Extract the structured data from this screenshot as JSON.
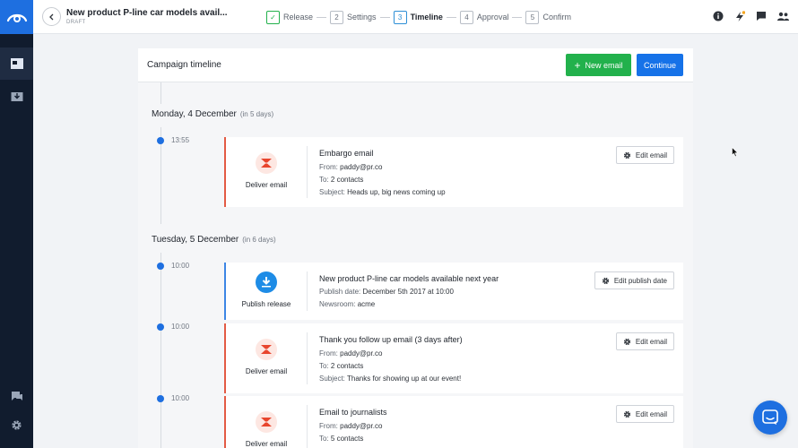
{
  "app": {
    "status_label": "DRAFT",
    "document_title": "New product P-line car models avail..."
  },
  "steps": [
    {
      "number": "✓",
      "label": "Release",
      "state": "done"
    },
    {
      "number": "2",
      "label": "Settings",
      "state": "todo"
    },
    {
      "number": "3",
      "label": "Timeline",
      "state": "current"
    },
    {
      "number": "4",
      "label": "Approval",
      "state": "todo"
    },
    {
      "number": "5",
      "label": "Confirm",
      "state": "todo"
    }
  ],
  "toolbar_icons": [
    "info-icon",
    "activity-icon",
    "chat-icon",
    "people-icon"
  ],
  "card": {
    "title": "Campaign timeline",
    "new_email_label": "New email",
    "continue_label": "Continue"
  },
  "days": [
    {
      "date": "Monday, 4 December",
      "relative": "(in 5 days)"
    },
    {
      "date": "Tuesday, 5 December",
      "relative": "(in 6 days)"
    }
  ],
  "entries": [
    {
      "time": "13:55",
      "kind": "Deliver email",
      "title": "Embargo email",
      "lines": [
        {
          "key": "From:",
          "value": "paddy@pr.co"
        },
        {
          "key": "To:",
          "value": "2 contacts"
        },
        {
          "key": "Subject:",
          "value": "Heads up, big news coming up"
        }
      ],
      "action": "Edit email"
    },
    {
      "time": "10:00",
      "kind": "Publish release",
      "title": "New product P-line car models available next year",
      "lines": [
        {
          "key": "Publish date:",
          "value": "December 5th 2017 at 10:00"
        },
        {
          "key": "Newsroom:",
          "value": "acme"
        }
      ],
      "action": "Edit publish date"
    },
    {
      "time": "10:00",
      "kind": "Deliver email",
      "title": "Thank you follow up email (3 days after)",
      "lines": [
        {
          "key": "From:",
          "value": "paddy@pr.co"
        },
        {
          "key": "To:",
          "value": "2 contacts"
        },
        {
          "key": "Subject:",
          "value": "Thanks for showing up at our event!"
        }
      ],
      "action": "Edit email"
    },
    {
      "time": "10:00",
      "kind": "Deliver email",
      "title": "Email to journalists",
      "lines": [
        {
          "key": "From:",
          "value": "paddy@pr.co"
        },
        {
          "key": "To:",
          "value": "5 contacts"
        }
      ],
      "action": "Edit email"
    }
  ],
  "colors": {
    "brand_blue": "#1e6fe0",
    "success_green": "#22b14c",
    "email_accent": "#e35b45",
    "release_accent": "#3d86e5",
    "sidebar_dark": "#111c2e"
  }
}
